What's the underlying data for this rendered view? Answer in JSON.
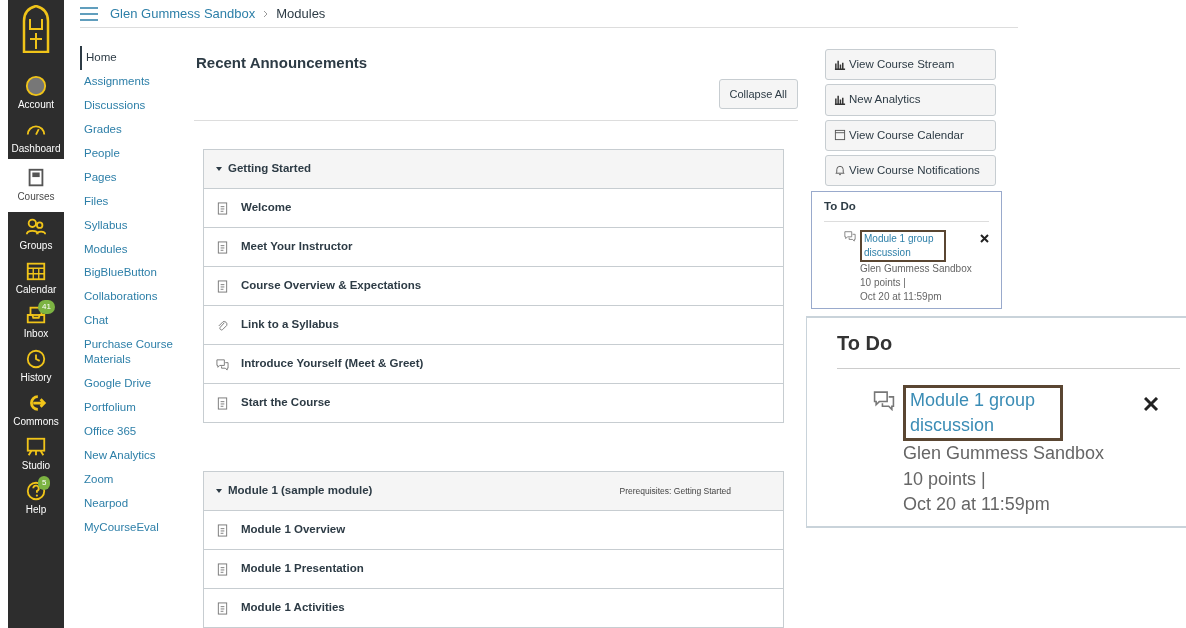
{
  "global_nav": {
    "items": [
      {
        "label": "Account",
        "selected": false
      },
      {
        "label": "Dashboard",
        "selected": false
      },
      {
        "label": "Courses",
        "selected": true
      },
      {
        "label": "Groups",
        "selected": false
      },
      {
        "label": "Calendar",
        "selected": false
      },
      {
        "label": "Inbox",
        "selected": false,
        "badge": "41"
      },
      {
        "label": "History",
        "selected": false
      },
      {
        "label": "Commons",
        "selected": false
      },
      {
        "label": "Studio",
        "selected": false
      },
      {
        "label": "Help",
        "selected": false,
        "badge": "5"
      }
    ]
  },
  "breadcrumb": [
    "Glen Gummess Sandbox",
    "Modules"
  ],
  "course_nav": {
    "items": [
      {
        "label": "Home",
        "selected": true
      },
      {
        "label": "Assignments",
        "selected": false
      },
      {
        "label": "Discussions",
        "selected": false
      },
      {
        "label": "Grades",
        "selected": false
      },
      {
        "label": "People",
        "selected": false
      },
      {
        "label": "Pages",
        "selected": false
      },
      {
        "label": "Files",
        "selected": false
      },
      {
        "label": "Syllabus",
        "selected": false
      },
      {
        "label": "Modules",
        "selected": false
      },
      {
        "label": "BigBlueButton",
        "selected": false
      },
      {
        "label": "Collaborations",
        "selected": false
      },
      {
        "label": "Chat",
        "selected": false
      },
      {
        "label": "Purchase Course Materials",
        "selected": false
      },
      {
        "label": "Google Drive",
        "selected": false
      },
      {
        "label": "Portfolium",
        "selected": false
      },
      {
        "label": "Office 365",
        "selected": false
      },
      {
        "label": "New Analytics",
        "selected": false
      },
      {
        "label": "Zoom",
        "selected": false
      },
      {
        "label": "Nearpod",
        "selected": false
      },
      {
        "label": "MyCourseEval",
        "selected": false
      }
    ]
  },
  "main": {
    "heading": "Recent Announcements",
    "collapse_button": "Collapse All",
    "modules": [
      {
        "title": "Getting Started",
        "expanded": true,
        "items": [
          {
            "title": "Welcome",
            "kind": "page"
          },
          {
            "title": "Meet Your Instructor",
            "kind": "page"
          },
          {
            "title": "Course Overview & Expectations",
            "kind": "page"
          },
          {
            "title": "Link to a Syllabus",
            "kind": "link"
          },
          {
            "title": "Introduce Yourself (Meet & Greet)",
            "kind": "discussion"
          },
          {
            "title": "Start the Course",
            "kind": "page"
          }
        ]
      },
      {
        "title": "Module 1 (sample module)",
        "prerequisites": "Prerequisites: Getting Started",
        "expanded": true,
        "items": [
          {
            "title": "Module 1 Overview",
            "kind": "page"
          },
          {
            "title": "Module 1 Presentation",
            "kind": "page"
          },
          {
            "title": "Module 1 Activities",
            "kind": "page"
          }
        ]
      }
    ]
  },
  "sidebar": {
    "buttons": [
      {
        "label": "View Course Stream",
        "kind": "chart"
      },
      {
        "label": "New Analytics",
        "kind": "chart"
      },
      {
        "label": "View Course Calendar",
        "kind": "calendar"
      },
      {
        "label": "View Course Notifications",
        "kind": "bell"
      }
    ],
    "todo": {
      "title": "To Do",
      "items": [
        {
          "title": "Module 1 group discussion",
          "course": "Glen Gummess Sandbox",
          "points": "10 points  |",
          "due": "Oct 20 at 11:59pm"
        }
      ]
    }
  },
  "zoom_callout": {
    "title": "To Do",
    "items": [
      {
        "title": "Module 1 group discussion",
        "course": "Glen Gummess Sandbox",
        "points": "10 points  |",
        "due": "Oct 20 at 11:59pm"
      }
    ]
  }
}
